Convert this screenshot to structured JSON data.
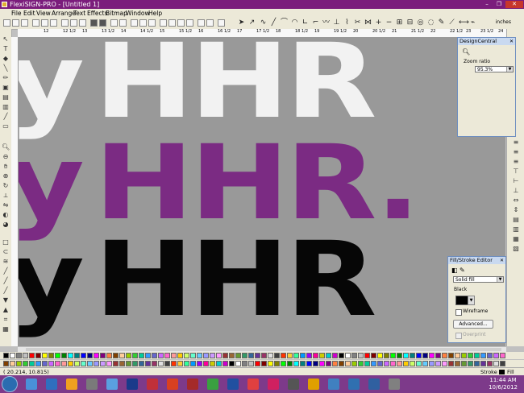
{
  "window": {
    "title": "FlexiSIGN-PRO - [Untitled 1]",
    "min": "–",
    "max": "❐",
    "close": "✕"
  },
  "menu": [
    "File",
    "Edit",
    "View",
    "Arrange",
    "Text",
    "Effects",
    "Bitmap",
    "Window",
    "Help"
  ],
  "toolbar": {
    "units": "inches"
  },
  "ruler": {
    "ticks": [
      "12",
      "12 1/2",
      "13",
      "13 1/2",
      "14",
      "14 1/2",
      "15",
      "15 1/2",
      "16",
      "16 1/2",
      "17",
      "17 1/2",
      "18",
      "18 1/2",
      "19",
      "19 1/2",
      "20",
      "20 1/2",
      "21",
      "21 1/2",
      "22",
      "22 1/2",
      "23",
      "23 1/2",
      "24"
    ]
  },
  "canvas": {
    "background": "#999999",
    "rows": [
      {
        "text": "HHR",
        "left_glyph": "y",
        "color": "#f2f2f2"
      },
      {
        "text": "HHR.",
        "left_glyph": "y",
        "color": "#7b2b83"
      },
      {
        "text": "HHR",
        "left_glyph": "y",
        "color": "#060606"
      }
    ]
  },
  "design_central": {
    "title": "DesignCentral",
    "zoom_label": "Zoom ratio",
    "zoom_value": "95.3%"
  },
  "fill_stroke": {
    "title": "Fill/Stroke Editor",
    "fill_type": "Solid fill",
    "color_label": "Black",
    "wireframe_label": "Wireframe",
    "advanced_label": "Advanced...",
    "overprint_label": "Overprint",
    "swatch_color": "#000000"
  },
  "palette_colors": [
    "#000000",
    "#ffffff",
    "#808080",
    "#c0c0c0",
    "#ff0000",
    "#800000",
    "#ffff00",
    "#808000",
    "#00ff00",
    "#008000",
    "#00ffff",
    "#008080",
    "#0000ff",
    "#000080",
    "#ff00ff",
    "#800080",
    "#ff8040",
    "#804000",
    "#ffcc99",
    "#99cc00",
    "#33cc33",
    "#00cc99",
    "#3399ff",
    "#6666cc",
    "#cc66ff",
    "#ff66cc",
    "#ff9999",
    "#ffcc00",
    "#ccff66",
    "#66ffcc",
    "#66ccff",
    "#9999ff",
    "#cc99ff",
    "#ff99ff",
    "#993333",
    "#996633",
    "#669933",
    "#339966",
    "#336699",
    "#663399",
    "#993366",
    "#e0e0e0",
    "#404040",
    "#ff3300",
    "#ffcc33",
    "#33ff99",
    "#0099ff",
    "#9900ff",
    "#ff0099",
    "#cccc00",
    "#00cccc",
    "#cc00cc"
  ],
  "status": {
    "coords": "( 20.214,     10.815)",
    "stroke_label": "Stroke",
    "fill_label": "Fill"
  },
  "taskbar": {
    "icons": [
      "#4a90d9",
      "#2f6fbf",
      "#f0a020",
      "#7a7a7a",
      "#5aa0e0",
      "#1a3a8a",
      "#c0303a",
      "#d84020",
      "#a52a2a",
      "#3aa040",
      "#2050a0",
      "#e04040",
      "#d02060",
      "#555555",
      "#e0a000",
      "#4080c0",
      "#3070b0",
      "#3060a0",
      "#808080"
    ],
    "time": "11:44 AM",
    "date": "10/6/2012"
  }
}
